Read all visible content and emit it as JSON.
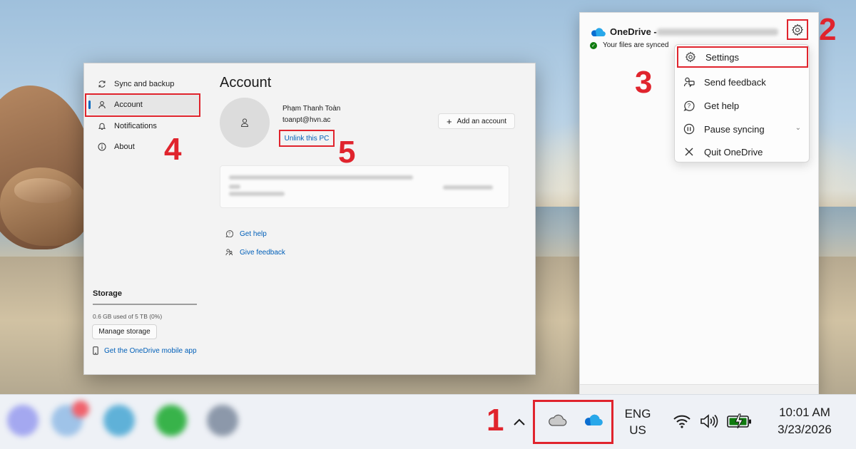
{
  "settings": {
    "nav": [
      {
        "label": "Sync and backup",
        "icon": "sync-icon"
      },
      {
        "label": "Account",
        "icon": "person-icon",
        "active": true
      },
      {
        "label": "Notifications",
        "icon": "bell-icon"
      },
      {
        "label": "About",
        "icon": "info-icon"
      }
    ],
    "storage": {
      "title": "Storage",
      "used_text": "0.6 GB used of 5 TB (0%)",
      "used_fraction": 0.0,
      "manage_label": "Manage storage",
      "mobile_link": "Get the OneDrive mobile app"
    },
    "account": {
      "title": "Account",
      "user_name": "Phạm Thanh Toàn",
      "user_email": "toanpt@hvn.ac",
      "unlink_label": "Unlink this PC",
      "add_account_label": "Add an account"
    },
    "links": {
      "get_help": "Get help",
      "give_feedback": "Give feedback"
    }
  },
  "flyout": {
    "title": "OneDrive -",
    "status": "Your files are synced",
    "menu": [
      {
        "label": "Settings",
        "icon": "gear-icon"
      },
      {
        "label": "Send feedback",
        "icon": "feedback-icon"
      },
      {
        "label": "Get help",
        "icon": "help-icon"
      },
      {
        "label": "Pause syncing",
        "icon": "pause-icon"
      },
      {
        "label": "Quit OneDrive",
        "icon": "close-icon"
      }
    ]
  },
  "taskbar": {
    "lang_line1": "ENG",
    "lang_line2": "US",
    "time": "10:01 AM",
    "date": "3/23/2026"
  },
  "annotations": {
    "n1": "1",
    "n2": "2",
    "n3": "3",
    "n4": "4",
    "n5": "5"
  },
  "colors": {
    "annotation_red": "#e0242d",
    "link_blue": "#005fb8",
    "onedrive_blue": "#0a6ed1",
    "synced_green": "#0f7b0f"
  }
}
